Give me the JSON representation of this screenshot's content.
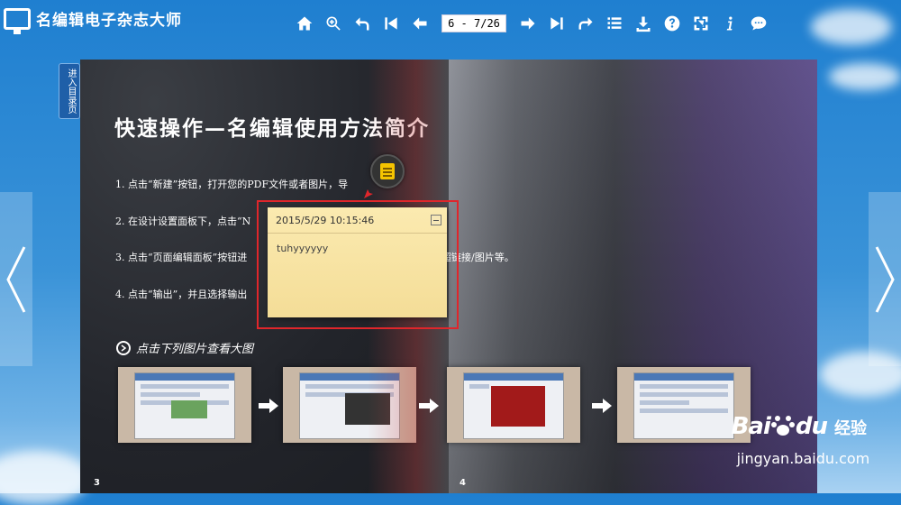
{
  "app": {
    "title": "名编辑电子杂志大师"
  },
  "toolbar": {
    "page_indicator": "6 - 7/26",
    "buttons": [
      "home-icon",
      "zoom-in-icon",
      "back-icon",
      "first-page-icon",
      "prev-page-icon",
      "next-page-icon",
      "last-page-icon",
      "share-icon",
      "toc-list-icon",
      "download-icon",
      "help-icon",
      "fullscreen-icon",
      "info-icon",
      "comment-icon"
    ]
  },
  "sidebar": {
    "toc_tab": "进入目录页"
  },
  "page_left": {
    "title": "快速操作—名编辑使用方法简介",
    "steps": [
      "1. 点击“新建”按钮，打开您的PDF文件或者图片，导",
      "2. 在设计设置面板下，点击“N",
      "3. 点击“页面编辑面板”按钮进",
      "4. 点击“输出”，并且选择输出"
    ],
    "step3_tail": "超链接/图片等。",
    "subheading": "点击下列图片查看大图",
    "page_number": "3"
  },
  "page_right": {
    "page_number": "4"
  },
  "note": {
    "timestamp": "2015/5/29 10:15:46",
    "content": "tuhyyyyyy"
  },
  "watermark": {
    "brand_left": "Bai",
    "brand_right": "du",
    "product": "经验",
    "url": "jingyan.baidu.com"
  },
  "colors": {
    "bar_bg": "#1f7fd0",
    "note_bg": "#f4dd97",
    "highlight": "#e0262b",
    "toc_tab": "#1f5fa8"
  }
}
